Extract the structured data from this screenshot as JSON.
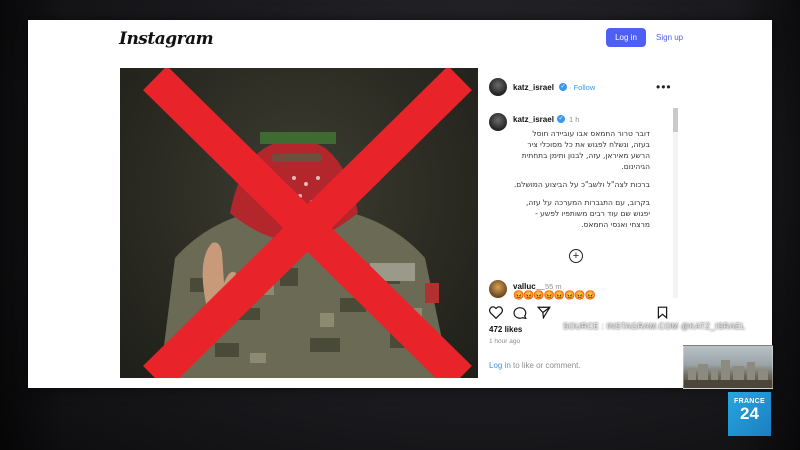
{
  "header": {
    "logo_text": "Instagram",
    "login_label": "Log in",
    "signup_label": "Sign up"
  },
  "post": {
    "username": "katz_israel",
    "follow_label": "Follow",
    "more_icon": "•••",
    "caption_username": "katz_israel",
    "caption_time": "1 h",
    "caption_paragraphs": [
      "דובר טרור החמאס אבו עוביידה חוסל\nבעזה, ונשלח לפגוש את כל מסוכלי ציר\nהרשע מאיראן, עזה, לבנון ותימן בתחתית\nהגיהינום.",
      "ברכות לצה\"ל ולשב\"כ על הביצוע המושלם.",
      "בקרוב, עם התגברות המערכה על עזה,\nיפגוש שם עוד רבים משותפיו לפשע -\nמרצחי ואנסי החמאס."
    ],
    "load_more_icon": "plus-circle-icon",
    "comment_username": "valluc__",
    "comment_time": "55 m",
    "comment_emojis": "😡😡😡😡😡😡😡😡",
    "likes": "472 likes",
    "posted_ago": "1 hour ago",
    "login_link": "Log in",
    "login_suffix": " to like or comment."
  },
  "overlay": {
    "source": "SOURCE : INSTAGRAM.COM @KATZ_ISRAEL",
    "channel_line1": "FRANCE",
    "channel_line2": "24"
  },
  "colors": {
    "accent": "#4e5ff5",
    "link": "#3897f0",
    "cross": "#e8242a",
    "france24": "#1b7fc2"
  }
}
